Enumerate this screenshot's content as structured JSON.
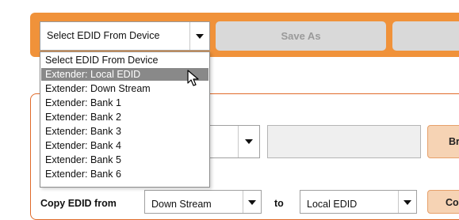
{
  "toolbar": {
    "select_value": "Select EDID From Device",
    "save_as_label": "Save As"
  },
  "dropdown": {
    "options": [
      "Select EDID From Device",
      "Extender: Local EDID",
      "Extender: Down Stream",
      "Extender: Bank 1",
      "Extender: Bank 2",
      "Extender: Bank 3",
      "Extender: Bank 4",
      "Extender: Bank 5",
      "Extender: Bank 6"
    ],
    "highlighted_index": 1
  },
  "load_row": {
    "browse_label": "Bro"
  },
  "copy_row": {
    "label": "Copy EDID from",
    "from_value": "Down Stream",
    "to_label": "to",
    "to_value": "Local EDID",
    "copy_button_label": "Co"
  },
  "colors": {
    "accent_orange": "#f0923a",
    "highlight_gray": "#898989"
  }
}
